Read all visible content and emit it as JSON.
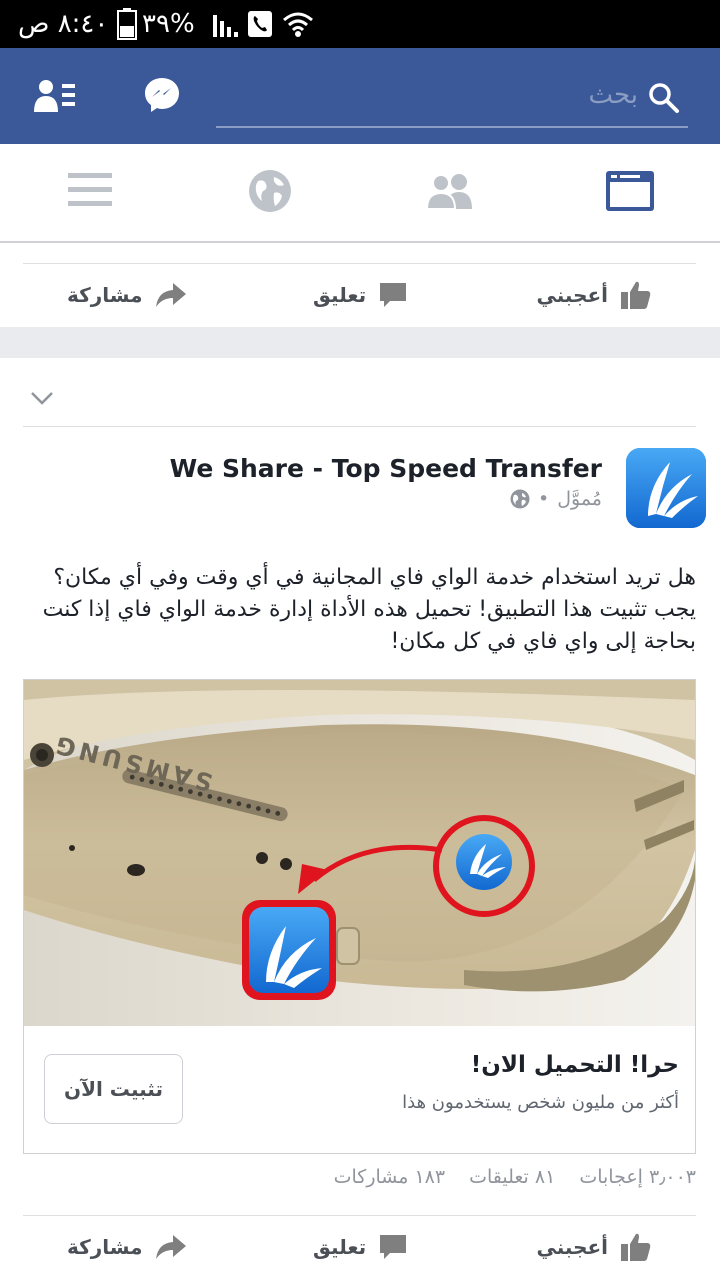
{
  "status_bar": {
    "time": "٨:٤٠ ص",
    "battery": "٣٩%"
  },
  "top_bar": {
    "search_placeholder": "بحث"
  },
  "action_bar": {
    "like_label": "أعجبني",
    "comment_label": "تعليق",
    "share_label": "مشاركة"
  },
  "post": {
    "page_name": "We Share - Top Speed Transfer",
    "sponsored_label": "مُموَّل",
    "meta_separator": "•",
    "text": "هل تريد استخدام خدمة الواي فاي المجانية في أي وقت وفي أي مكان؟ يجب تثبيت هذا التطبيق! تحميل هذه الأداة إدارة خدمة الواي فاي إذا كنت بحاجة إلى واي فاي في كل مكان!",
    "image_brand_text": "SAMSUNG",
    "cta_title": "حرا! التحميل الان!",
    "cta_subtitle": "أكثر من مليون شخص يستخدمون هذا",
    "install_button_label": "تثبيت الآن",
    "reactions": "٣٫٠٠٣ إعجابات",
    "comments": "٨١ تعليقات",
    "shares": "١٨٣ مشاركات"
  },
  "colors": {
    "brand_blue": "#3b5998",
    "app_icon_blue": "#1d86e8",
    "red_annotation": "#e0141e",
    "active_tab": "#3b5998",
    "inactive_tab": "#bec3c9"
  }
}
